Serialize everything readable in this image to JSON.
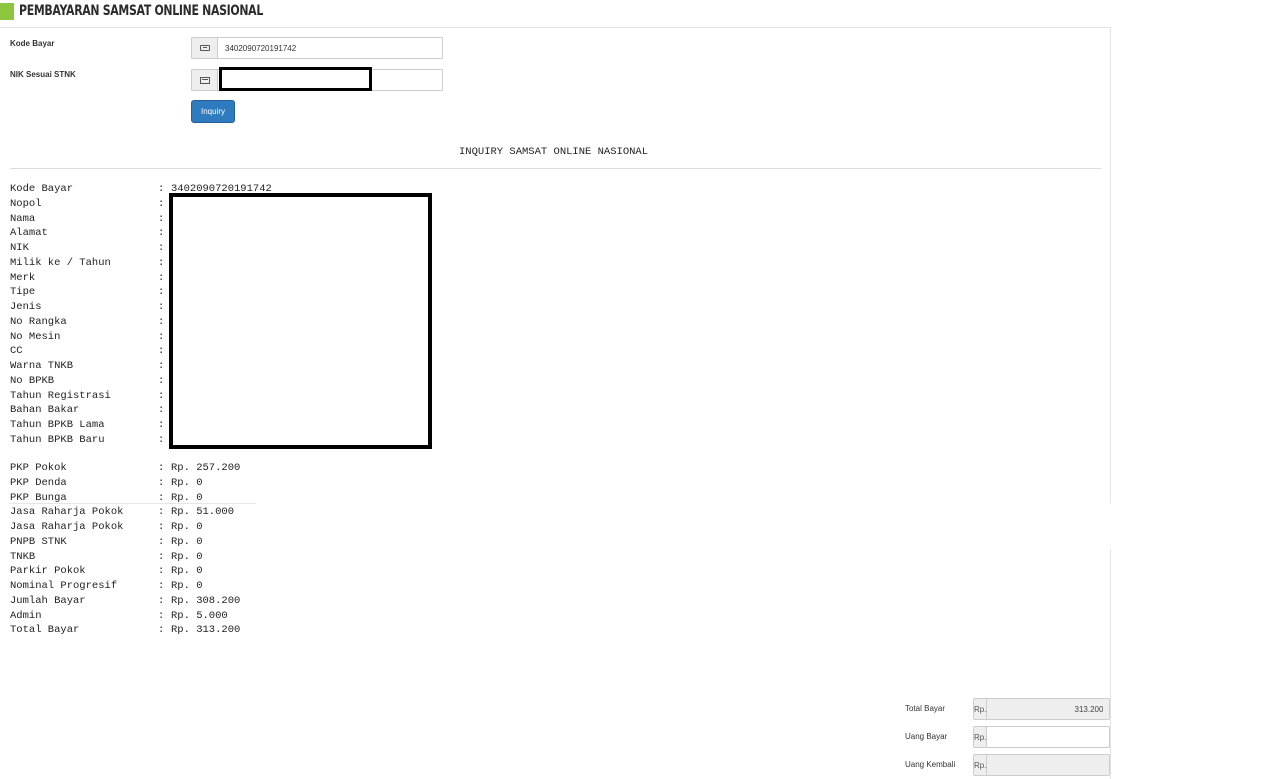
{
  "header": {
    "title": "PEMBAYARAN SAMSAT ONLINE NASIONAL"
  },
  "form": {
    "kode_bayar_label": "Kode Bayar",
    "kode_bayar_value": "3402090720191742",
    "nik_label": "NIK Sesuai STNK",
    "nik_value": "",
    "inquiry_button": "Inquiry"
  },
  "report": {
    "title": "INQUIRY SAMSAT ONLINE NASIONAL",
    "separator": ":",
    "vehicle_rows": [
      {
        "label": "Kode Bayar",
        "value": "3402090720191742"
      },
      {
        "label": "Nopol",
        "value": ""
      },
      {
        "label": "Nama",
        "value": ""
      },
      {
        "label": "Alamat",
        "value": ""
      },
      {
        "label": "NIK",
        "value": ""
      },
      {
        "label": "Milik ke / Tahun",
        "value": ""
      },
      {
        "label": "Merk",
        "value": ""
      },
      {
        "label": "Tipe",
        "value": ""
      },
      {
        "label": "Jenis",
        "value": ""
      },
      {
        "label": "No Rangka",
        "value": ""
      },
      {
        "label": "No Mesin",
        "value": ""
      },
      {
        "label": "CC",
        "value": ""
      },
      {
        "label": "Warna TNKB",
        "value": ""
      },
      {
        "label": "No BPKB",
        "value": ""
      },
      {
        "label": "Tahun Registrasi",
        "value": ""
      },
      {
        "label": "Bahan Bakar",
        "value": ""
      },
      {
        "label": "Tahun BPKB Lama",
        "value": ""
      },
      {
        "label": "Tahun BPKB Baru",
        "value": ""
      }
    ],
    "fee_rows": [
      {
        "label": "PKP Pokok",
        "value": "Rp. 257.200"
      },
      {
        "label": "PKP Denda",
        "value": "Rp. 0"
      },
      {
        "label": "PKP Bunga",
        "value": "Rp. 0"
      },
      {
        "label": "Jasa Raharja Pokok",
        "value": "Rp. 51.000"
      },
      {
        "label": "Jasa Raharja Pokok",
        "value": "Rp. 0"
      },
      {
        "label": "PNPB STNK",
        "value": "Rp. 0"
      },
      {
        "label": "TNKB",
        "value": "Rp. 0"
      },
      {
        "label": "Parkir Pokok",
        "value": "Rp. 0"
      },
      {
        "label": "Nominal Progresif",
        "value": "Rp. 0"
      },
      {
        "label": "Jumlah Bayar",
        "value": "Rp. 308.200"
      },
      {
        "label": "Admin",
        "value": "Rp. 5.000"
      },
      {
        "label": "Total Bayar",
        "value": "Rp. 313.200"
      }
    ]
  },
  "payment": {
    "currency": "Rp.",
    "total_label": "Total Bayar",
    "total_value": "313.200",
    "uang_bayar_label": "Uang Bayar",
    "uang_bayar_value": "",
    "uang_kembali_label": "Uang Kembali",
    "uang_kembali_value": ""
  },
  "icons": {
    "kode_bayar": "credit-card-icon",
    "nik": "id-card-icon"
  },
  "colors": {
    "accent": "#8cc63f",
    "button": "#2f7bc0"
  }
}
